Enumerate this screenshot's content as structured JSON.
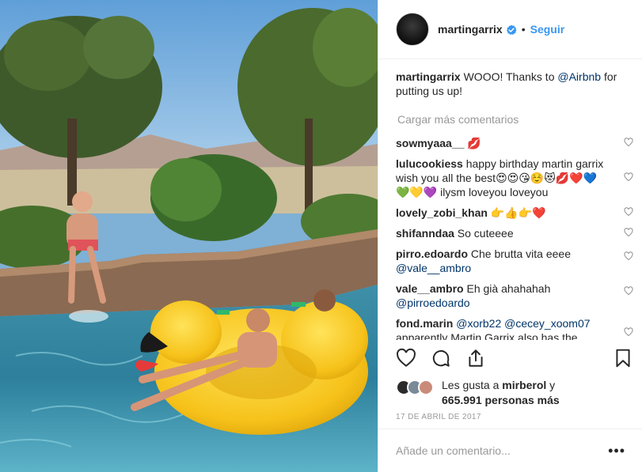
{
  "post": {
    "username": "martingarrix",
    "follow_label": "Seguir",
    "caption_user": "martingarrix",
    "caption_text": " WOOO! Thanks to ",
    "caption_mention": "@Airbnb",
    "caption_tail": " for putting us up!"
  },
  "comments": {
    "load_more": "Cargar más comentarios",
    "items": [
      {
        "user": "sowmyaaa__",
        "text": " 💋",
        "mention": "",
        "tail": ""
      },
      {
        "user": "lulucookiess",
        "text": " happy birthday martin garrix wish you all the best😍😍😘☺️😻💋❤️💙💚💛💜 ilysm loveyou loveyou",
        "mention": "",
        "tail": ""
      },
      {
        "user": "lovely_zobi_khan",
        "text": " 👉👍👉❤️",
        "mention": "",
        "tail": ""
      },
      {
        "user": "shifanndaa",
        "text": " So cuteeee",
        "mention": "",
        "tail": ""
      },
      {
        "user": "pirro.edoardo",
        "text": " Che brutta vita eeee ",
        "mention": "@vale__ambro",
        "tail": ""
      },
      {
        "user": "vale__ambro",
        "text": " Eh già ahahahah ",
        "mention": "@pirroedoardo",
        "tail": ""
      },
      {
        "user": "fond.marin",
        "text": " ",
        "mention": "@xorb22 @cecey_xoom07",
        "tail": " apparently Martin Garrix also has the"
      }
    ]
  },
  "likes": {
    "prefix": "Les gusta a ",
    "user": "mirberol",
    "middle": " y",
    "count": "665.991 personas más"
  },
  "date": "17 DE ABRIL DE 2017",
  "add_comment": {
    "placeholder": "Añade un comentario..."
  },
  "more_label": "•••",
  "colors": {
    "accent": "#3897f0",
    "mention": "#003569",
    "muted": "#999999",
    "duck": "#f5c518"
  },
  "icons": {
    "like": "heart-icon",
    "comment": "comment-icon",
    "share": "share-icon",
    "save": "bookmark-icon",
    "verified": "verified-badge-icon"
  }
}
